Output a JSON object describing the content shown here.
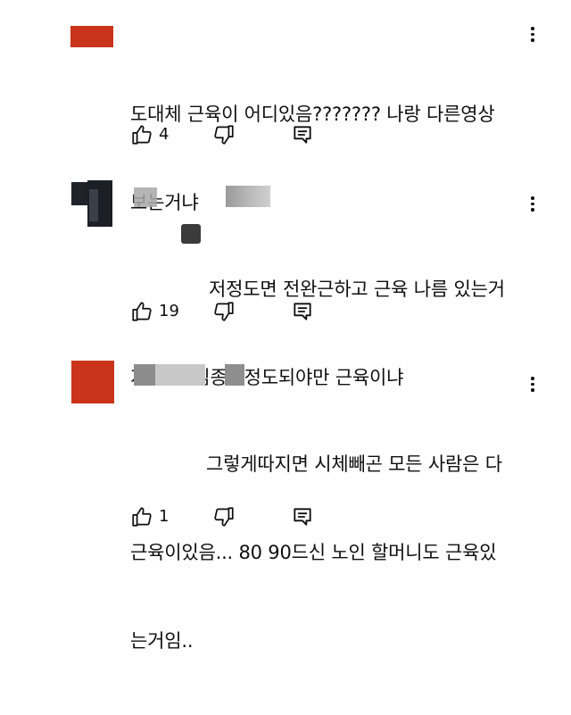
{
  "comments": [
    {
      "text_lines": [
        "도대체 근육이 어디있음??????? 나랑 다른영상",
        "보는거냐"
      ],
      "likes": "4",
      "avatar_color": "#c9341a"
    },
    {
      "text_lines": [
        "저정도면 전완근하고 근육 나름 있는거",
        "지 어디 김종국정도되야만 근육이냐"
      ],
      "likes": "19",
      "avatar_color": "#1f2229"
    },
    {
      "text_lines": [
        "그렇게따지면 시체빼곤 모든 사람은 다",
        "근육이있음... 80 90드신 노인 할머니도 근육있",
        "는거임.."
      ],
      "likes": "1",
      "avatar_color": "#c9341a"
    }
  ],
  "icons": {
    "like": "thumbs-up-icon",
    "dislike": "thumbs-down-icon",
    "reply": "reply-comment-icon",
    "more": "more-vert-icon"
  }
}
